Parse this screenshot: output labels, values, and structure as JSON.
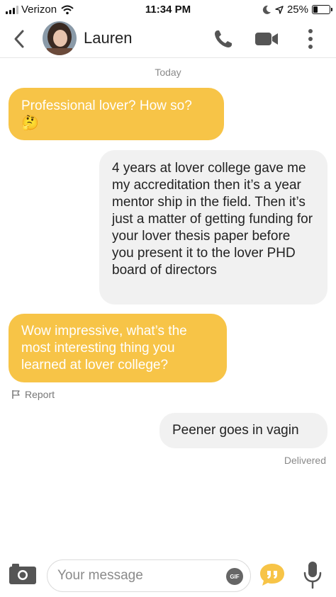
{
  "status_bar": {
    "carrier": "Verizon",
    "time": "11:34 PM",
    "battery": "25%",
    "battery_level": 0.25,
    "signal_bars_active": 3
  },
  "header": {
    "contact_name": "Lauren",
    "icons": {
      "back": "chevron-left-icon",
      "call": "phone-icon",
      "video": "video-camera-icon",
      "more": "more-vertical-icon"
    }
  },
  "conversation": {
    "day_label": "Today",
    "messages": [
      {
        "direction": "incoming",
        "text": "Professional lover? How so?",
        "emoji": "🤔"
      },
      {
        "direction": "outgoing",
        "text": "4 years at lover college gave me my accreditation then it’s a year mentor ship in the field. Then it’s just a matter of getting funding for your lover thesis paper before you present it to the lover PHD board of directors"
      },
      {
        "direction": "incoming",
        "text": "Wow impressive, what’s the most interesting thing you learned at lover college?"
      },
      {
        "direction": "outgoing",
        "text": "Peener goes in vagin"
      }
    ],
    "report_label": "Report",
    "delivered_label": "Delivered"
  },
  "composer": {
    "placeholder": "Your message",
    "gif_label": "GIF"
  },
  "colors": {
    "accent": "#f7c447",
    "outgoing_bubble": "#f1f1f1",
    "icon_gray": "#555555"
  }
}
